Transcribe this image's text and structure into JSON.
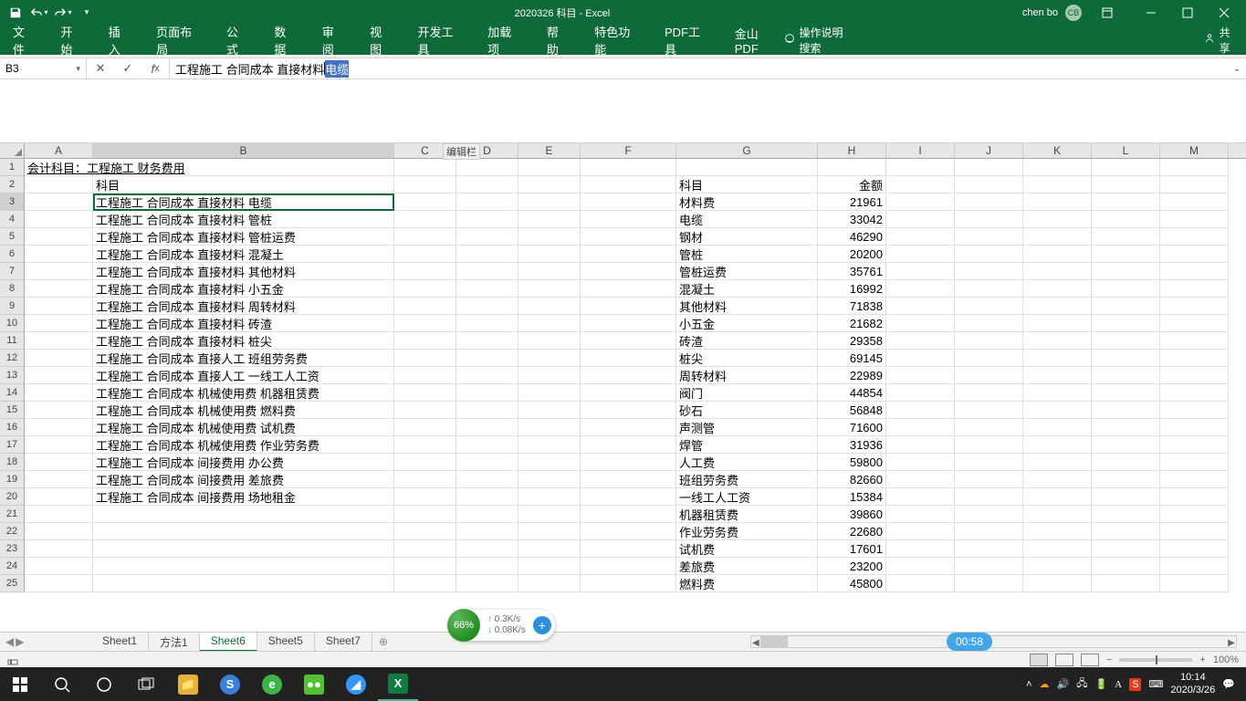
{
  "titlebar": {
    "doc_title": "2020326 科目  -  Excel",
    "user": "chen bo",
    "avatar": "CB"
  },
  "ribbon": {
    "tabs": [
      "文件",
      "开始",
      "插入",
      "页面布局",
      "公式",
      "数据",
      "审阅",
      "视图",
      "开发工具",
      "加载项",
      "帮助",
      "特色功能",
      "PDF工具",
      "金山PDF"
    ],
    "tell_me": "操作说明搜索",
    "share": "共享"
  },
  "formula": {
    "cell_ref": "B3",
    "text_prefix": "工程施工 合同成本 直接材料 ",
    "text_selected": "电缆",
    "tooltip": "编辑栏"
  },
  "columns": [
    "A",
    "B",
    "C",
    "D",
    "E",
    "F",
    "G",
    "H",
    "I",
    "J",
    "K",
    "L",
    "M"
  ],
  "row_count": 25,
  "active_cell": {
    "row": 3,
    "col": "B"
  },
  "cells": {
    "A1": "会计科目：工程施工 财务费用",
    "B2": "科目",
    "B3": "工程施工 合同成本 直接材料 电缆",
    "B4": "工程施工 合同成本 直接材料 管桩",
    "B5": "工程施工 合同成本 直接材料 管桩运费",
    "B6": "工程施工 合同成本 直接材料 混凝土",
    "B7": "工程施工 合同成本 直接材料 其他材料",
    "B8": "工程施工 合同成本 直接材料 小五金",
    "B9": "工程施工 合同成本 直接材料 周转材料",
    "B10": "工程施工 合同成本 直接材料 砖渣",
    "B11": "工程施工 合同成本 直接材料 桩尖",
    "B12": "工程施工 合同成本 直接人工 班组劳务费",
    "B13": "工程施工 合同成本 直接人工 一线工人工资",
    "B14": "工程施工 合同成本 机械使用费 机器租赁费",
    "B15": "工程施工 合同成本 机械使用费 燃料费",
    "B16": "工程施工 合同成本 机械使用费 试机费",
    "B17": "工程施工 合同成本 机械使用费 作业劳务费",
    "B18": "工程施工 合同成本 间接费用 办公费",
    "B19": "工程施工 合同成本 间接费用 差旅费",
    "B20": "工程施工 合同成本 间接费用 场地租金",
    "G2": "科目",
    "H2": "金额",
    "G3": "材料费",
    "H3": "21961",
    "G4": "电缆",
    "H4": "33042",
    "G5": "钢材",
    "H5": "46290",
    "G6": "管桩",
    "H6": "20200",
    "G7": "管桩运费",
    "H7": "35761",
    "G8": "混凝土",
    "H8": "16992",
    "G9": "其他材料",
    "H9": "71838",
    "G10": "小五金",
    "H10": "21682",
    "G11": "砖渣",
    "H11": "29358",
    "G12": "桩尖",
    "H12": "69145",
    "G13": "周转材料",
    "H13": "22989",
    "G14": "阀门",
    "H14": "44854",
    "G15": "砂石",
    "H15": "56848",
    "G16": "声测管",
    "H16": "71600",
    "G17": "焊管",
    "H17": "31936",
    "G18": "人工费",
    "H18": "59800",
    "G19": "班组劳务费",
    "H19": "82660",
    "G20": "一线工人工资",
    "H20": "15384",
    "G21": "机器租赁费",
    "H21": "39860",
    "G22": "作业劳务费",
    "H22": "22680",
    "G23": "试机费",
    "H23": "17601",
    "G24": "差旅费",
    "H24": "23200",
    "G25": "燃料费",
    "H25": "45800"
  },
  "sheets": {
    "tabs": [
      "Sheet1",
      "方法1",
      "Sheet6",
      "Sheet5",
      "Sheet7"
    ],
    "active": 2
  },
  "status": {
    "zoom": "100%"
  },
  "netspeed": {
    "pct": "66%",
    "up": "0.3K/s",
    "down": "0.08K/s"
  },
  "clock_bubble": "00:58",
  "taskbar": {
    "time": "10:14",
    "date": "2020/3/26"
  }
}
